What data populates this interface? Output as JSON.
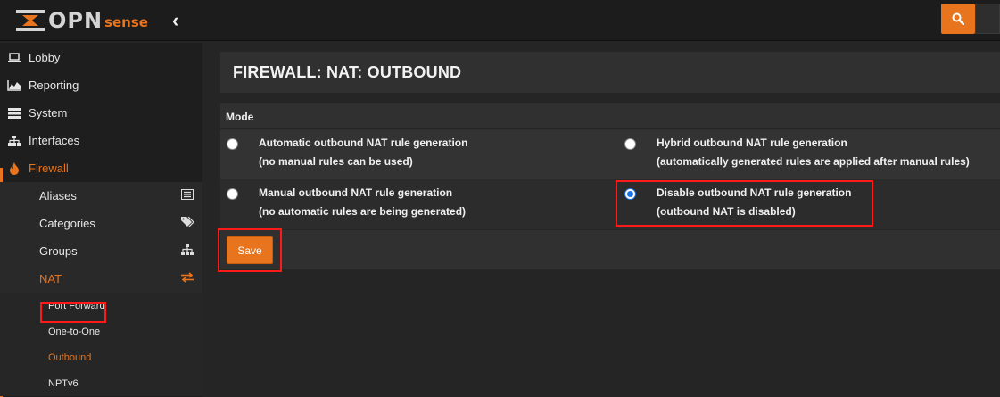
{
  "brand": {
    "name": "OPN",
    "sub": "sense"
  },
  "topbar": {
    "collapse_glyph": "‹",
    "search_icon": "search-icon"
  },
  "sidebar": {
    "items": [
      {
        "label": "Lobby",
        "icon": "laptop-icon"
      },
      {
        "label": "Reporting",
        "icon": "area-chart-icon"
      },
      {
        "label": "System",
        "icon": "server-icon"
      },
      {
        "label": "Interfaces",
        "icon": "sitemap-icon"
      },
      {
        "label": "Firewall",
        "icon": "fire-icon",
        "active": true
      }
    ],
    "firewall_sub": [
      {
        "label": "Aliases",
        "icon": "list-alt-icon"
      },
      {
        "label": "Categories",
        "icon": "tags-icon"
      },
      {
        "label": "Groups",
        "icon": "sitemap-icon"
      },
      {
        "label": "NAT",
        "icon": "exchange-icon",
        "active": true
      }
    ],
    "nat_sub": [
      {
        "label": "Port Forward"
      },
      {
        "label": "One-to-One"
      },
      {
        "label": "Outbound",
        "active": true
      },
      {
        "label": "NPTv6"
      }
    ]
  },
  "page": {
    "title": "FIREWALL: NAT: OUTBOUND",
    "mode_label": "Mode",
    "options": [
      {
        "line1": "Automatic outbound NAT rule generation",
        "line2": "(no manual rules can be used)",
        "selected": false
      },
      {
        "line1": "Hybrid outbound NAT rule generation",
        "line2": "(automatically generated rules are applied after manual rules)",
        "selected": false
      },
      {
        "line1": "Manual outbound NAT rule generation",
        "line2": "(no automatic rules are being generated)",
        "selected": false
      },
      {
        "line1": "Disable outbound NAT rule generation",
        "line2": "(outbound NAT is disabled)",
        "selected": true
      }
    ],
    "save_label": "Save"
  },
  "colors": {
    "accent": "#e8741d",
    "highlight": "#ff1a1a",
    "radio_selected": "#1a73e8"
  }
}
